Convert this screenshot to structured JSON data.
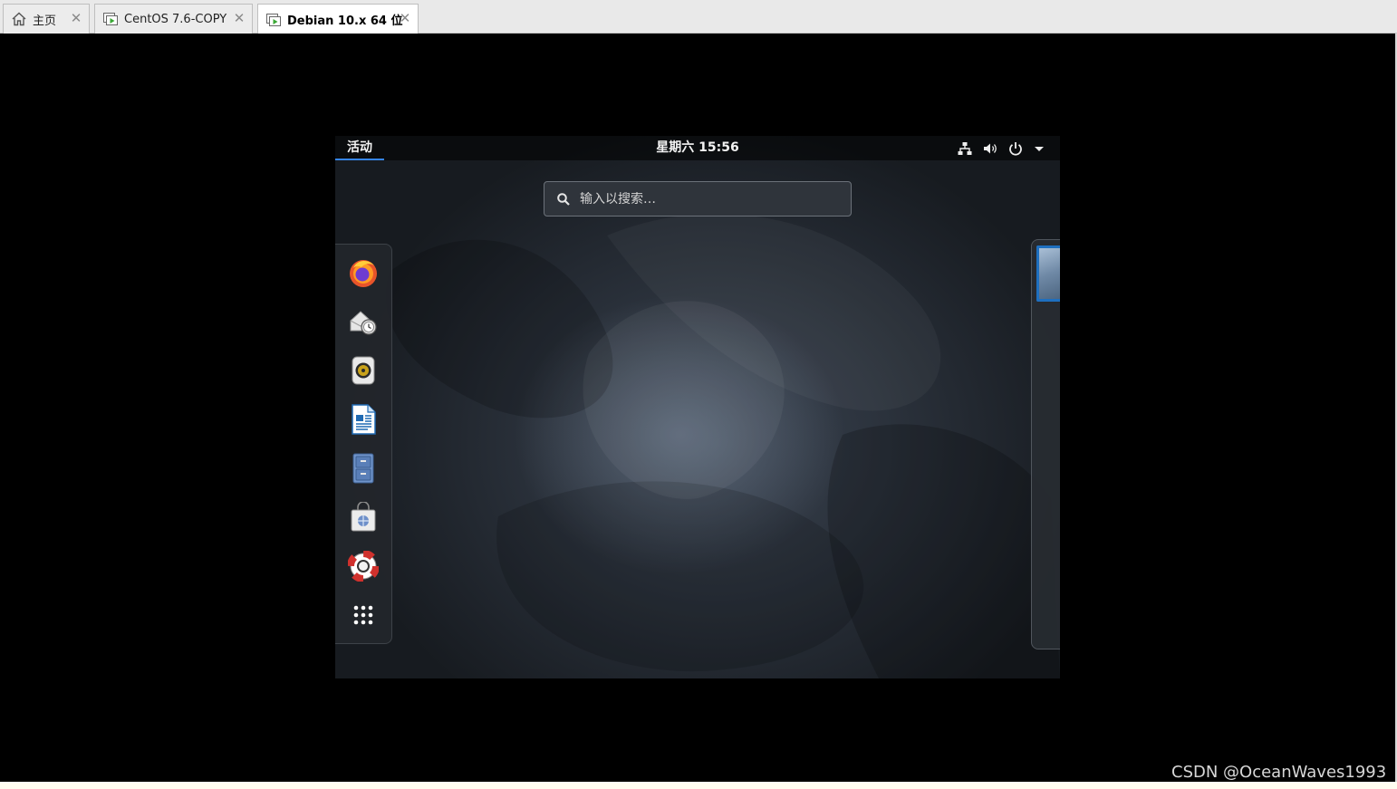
{
  "host_tabs": [
    {
      "label": "主页",
      "icon": "home-icon",
      "active": false
    },
    {
      "label": "CentOS 7.6-COPY",
      "icon": "vm-icon",
      "active": false
    },
    {
      "label": "Debian 10.x 64 位",
      "icon": "vm-icon",
      "active": true
    }
  ],
  "close_glyph": "✕",
  "guest": {
    "activities_label": "活动",
    "clock": "星期六 15:56",
    "search": {
      "placeholder": "输入以搜索…",
      "value": ""
    },
    "tray": [
      "network-icon",
      "volume-icon",
      "power-icon",
      "dropdown-arrow-icon"
    ],
    "dash": [
      {
        "name": "firefox-icon"
      },
      {
        "name": "evolution-mail-icon"
      },
      {
        "name": "rhythmbox-icon"
      },
      {
        "name": "libreoffice-writer-icon"
      },
      {
        "name": "files-icon"
      },
      {
        "name": "software-store-icon"
      },
      {
        "name": "help-icon"
      },
      {
        "name": "show-applications-icon"
      }
    ]
  },
  "colors": {
    "accent": "#3584e4",
    "workspace_border": "#1e6fbf"
  },
  "watermark": "CSDN @OceanWaves1993"
}
